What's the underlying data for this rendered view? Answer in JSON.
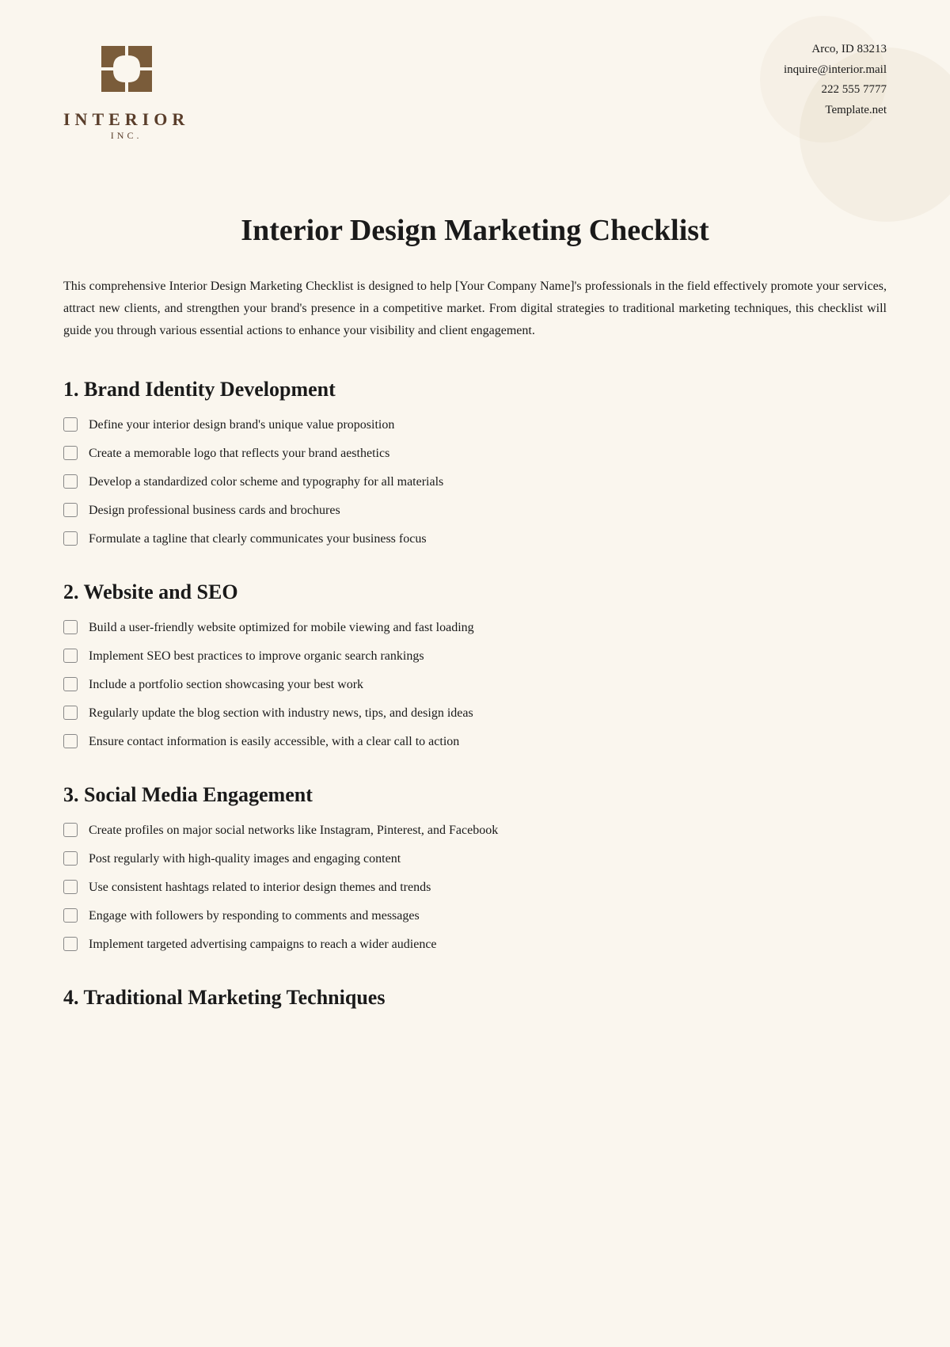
{
  "header": {
    "logo": {
      "company_name": "INTERIOR",
      "tagline": "INC."
    },
    "contact": {
      "address": "Arco, ID 83213",
      "email": "inquire@interior.mail",
      "phone": "222 555 7777",
      "website": "Template.net"
    }
  },
  "page": {
    "title": "Interior Design Marketing Checklist",
    "intro": "This comprehensive Interior Design Marketing Checklist is designed to help [Your Company Name]'s professionals in the field effectively promote your services, attract new clients, and strengthen your brand's presence in a competitive market. From digital strategies to traditional marketing techniques, this checklist will guide you through various essential actions to enhance your visibility and client engagement."
  },
  "sections": [
    {
      "id": "section-1",
      "title": "1. Brand Identity Development",
      "items": [
        "Define your interior design brand's unique value proposition",
        "Create a memorable logo that reflects your brand aesthetics",
        "Develop a standardized color scheme and typography for all materials",
        "Design professional business cards and brochures",
        "Formulate a tagline that clearly communicates your business focus"
      ]
    },
    {
      "id": "section-2",
      "title": "2. Website and SEO",
      "items": [
        "Build a user-friendly website optimized for mobile viewing and fast loading",
        "Implement SEO best practices to improve organic search rankings",
        "Include a portfolio section showcasing your best work",
        "Regularly update the blog section with industry news, tips, and design ideas",
        "Ensure contact information is easily accessible, with a clear call to action"
      ]
    },
    {
      "id": "section-3",
      "title": "3. Social Media Engagement",
      "items": [
        "Create profiles on major social networks like Instagram, Pinterest, and Facebook",
        "Post regularly with high-quality images and engaging content",
        "Use consistent hashtags related to interior design themes and trends",
        "Engage with followers by responding to comments and messages",
        "Implement targeted advertising campaigns to reach a wider audience"
      ]
    },
    {
      "id": "section-4",
      "title": "4. Traditional Marketing Techniques",
      "items": []
    }
  ]
}
